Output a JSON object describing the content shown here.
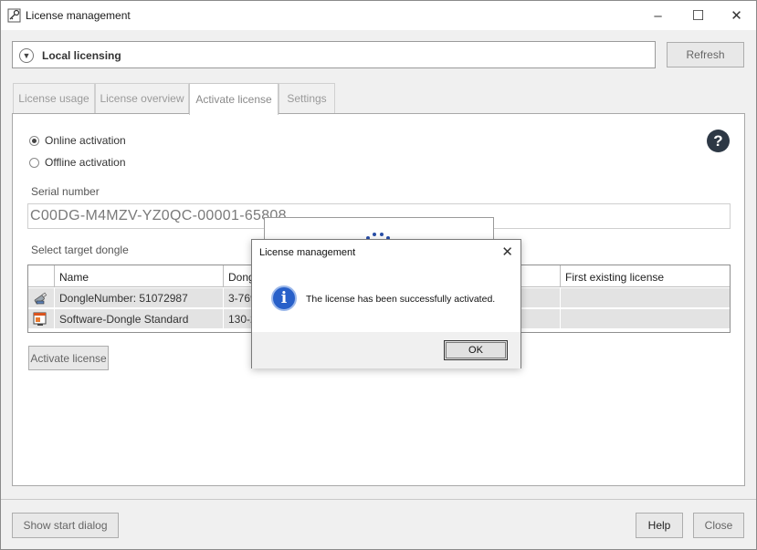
{
  "window": {
    "title": "License management",
    "minimize": "–",
    "maximize": "☐",
    "close": "✕"
  },
  "licensing": {
    "label": "Local licensing",
    "refresh": "Refresh"
  },
  "tabs": [
    {
      "label": "License usage"
    },
    {
      "label": "License overview"
    },
    {
      "label": "Activate license"
    },
    {
      "label": "Settings"
    }
  ],
  "activation": {
    "online": "Online activation",
    "offline": "Offline activation",
    "selected": "Online activation",
    "help_glyph": "?"
  },
  "serial": {
    "label": "Serial number",
    "value": "C00DG-M4MZV-YZ0QC-00001-65808"
  },
  "dongle": {
    "label": "Select target dongle",
    "columns": [
      "Name",
      "Dong",
      "First existing license"
    ],
    "rows": [
      {
        "name": "DongleNumber: 51072987",
        "dongle": "3-769",
        "first": ""
      },
      {
        "name": "Software-Dongle Standard",
        "dongle": "130-2",
        "first": ""
      }
    ]
  },
  "buttons": {
    "activate": "Activate license",
    "show_start": "Show start dialog",
    "help": "Help",
    "close": "Close"
  },
  "dialog": {
    "title": "License management",
    "close": "✕",
    "icon_glyph": "i",
    "message": "The license has been successfully activated.",
    "ok": "OK"
  },
  "colors": {
    "info": "#2860c9",
    "help_circle": "#2d3845"
  }
}
